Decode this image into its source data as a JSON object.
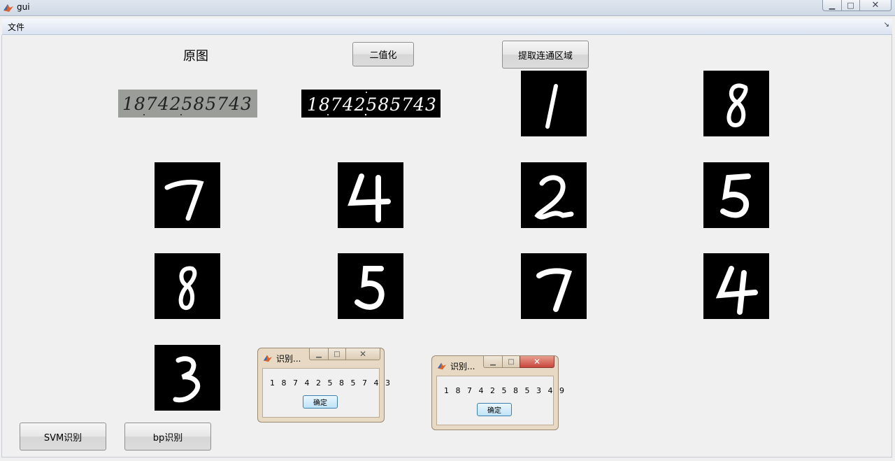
{
  "window": {
    "title": "gui"
  },
  "menu": {
    "file": "文件"
  },
  "labels": {
    "original": "原图"
  },
  "buttons": {
    "binarize": "二值化",
    "extract": "提取连通区域",
    "svm": "SVM识别",
    "bp": "bp识别"
  },
  "dialogs": [
    {
      "title": "识别...",
      "message": "1 8 7 4 2 5 8 5 7 4 3",
      "ok": "确定"
    },
    {
      "title": "识别...",
      "message": "1 8 7 4 2 5 8 5 3 4 9",
      "ok": "确定"
    }
  ],
  "images": {
    "original_text": "18742585743",
    "digits": [
      "1",
      "8",
      "7",
      "4",
      "2",
      "5",
      "8",
      "5",
      "7",
      "4",
      "3"
    ]
  },
  "colors": {
    "titlebar": "#cfd9e5",
    "dialog_frame": "#e7d9c3",
    "close_red": "#c9463d"
  }
}
